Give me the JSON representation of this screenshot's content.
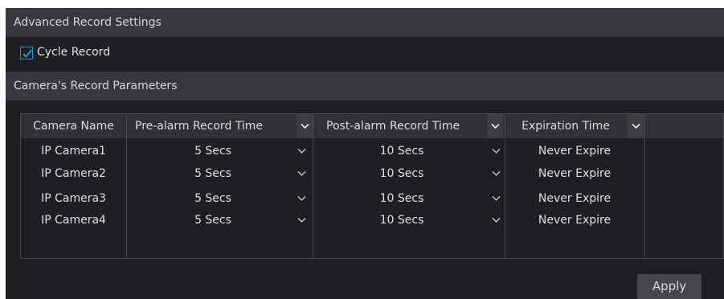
{
  "sections": {
    "advanced_title": "Advanced Record Settings",
    "params_title": "Camera's Record Parameters"
  },
  "cycle_record": {
    "label": "Cycle Record",
    "checked": true
  },
  "table": {
    "headers": {
      "camera_name": "Camera Name",
      "pre_alarm": "Pre-alarm Record Time",
      "post_alarm": "Post-alarm Record Time",
      "expiration": "Expiration Time"
    },
    "rows": [
      {
        "camera": "IP Camera1",
        "pre": "5 Secs",
        "post": "10 Secs",
        "expire": "Never Expire"
      },
      {
        "camera": "IP Camera2",
        "pre": "5 Secs",
        "post": "10 Secs",
        "expire": "Never Expire"
      },
      {
        "camera": "IP Camera3",
        "pre": "5 Secs",
        "post": "10 Secs",
        "expire": "Never Expire"
      },
      {
        "camera": "IP Camera4",
        "pre": "5 Secs",
        "post": "10 Secs",
        "expire": "Never Expire"
      }
    ]
  },
  "buttons": {
    "apply": "Apply"
  },
  "colors": {
    "accent": "#2b8fd6",
    "panel_bg": "#1e1f22",
    "header_bg": "#36383d"
  }
}
